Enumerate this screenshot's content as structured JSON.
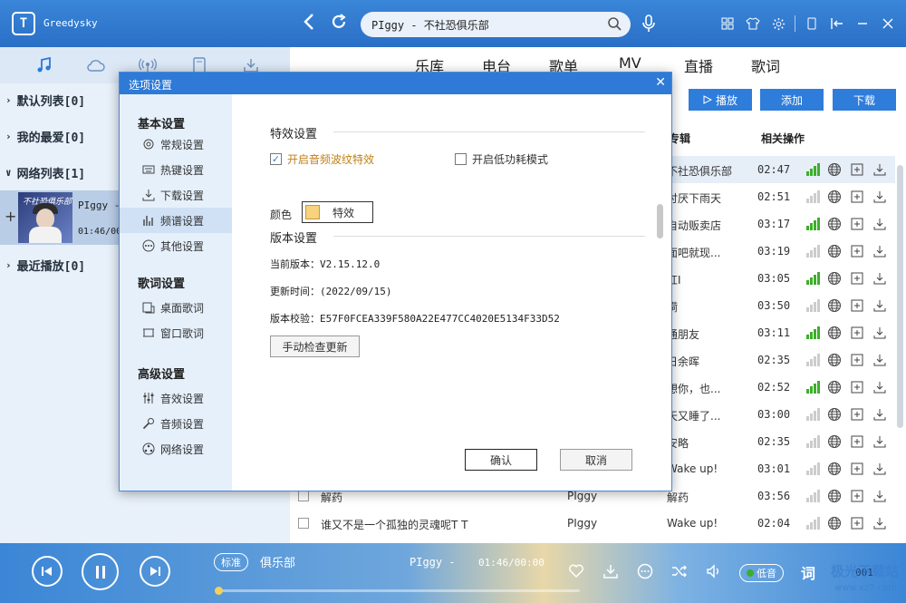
{
  "app": {
    "logo_letter": "T",
    "name": "Greedysky"
  },
  "search": {
    "value": "PIggy - 不社恐俱乐部"
  },
  "left": {
    "tabs": [
      "music-icon",
      "cloud-icon",
      "radio-icon",
      "device-icon",
      "download-icon"
    ],
    "lists": [
      {
        "label": "默认列表[0]",
        "arrow": "›"
      },
      {
        "label": "我的最爱[0]",
        "arrow": "›"
      },
      {
        "label": "网络列表[1]",
        "arrow": "∨"
      },
      {
        "label": "最近播放[0]",
        "arrow": "›"
      }
    ],
    "now": {
      "title": "PIggy -",
      "time": "01:46/00",
      "cover_caption": "不社恐俱乐部",
      "plus": "+"
    }
  },
  "main": {
    "tabs": [
      "乐库",
      "电台",
      "歌单",
      "MV",
      "直播",
      "歌词"
    ],
    "buttons": {
      "play": "播放",
      "add": "添加",
      "download": "下载"
    },
    "headers": {
      "album": "专辑",
      "ops": "相关操作"
    },
    "rows": [
      {
        "name": "",
        "singer": "",
        "album": "不社恐俱乐部",
        "dur": "02:47",
        "bars": 3,
        "hl": true
      },
      {
        "name": "",
        "singer": "",
        "album": "讨厌下雨天",
        "dur": "02:51",
        "bars": 0
      },
      {
        "name": "",
        "singer": "",
        "album": "自动贩卖店",
        "dur": "03:17",
        "bars": 3
      },
      {
        "name": "",
        "singer": "",
        "album": "面吧就现...",
        "dur": "03:19",
        "bars": 0
      },
      {
        "name": "",
        "singer": "",
        "album": "红I",
        "dur": "03:05",
        "bars": 3
      },
      {
        "name": "",
        "singer": "",
        "album": "嗬",
        "dur": "03:50",
        "bars": 0
      },
      {
        "name": "",
        "singer": "",
        "album": "通朋友",
        "dur": "03:11",
        "bars": 3
      },
      {
        "name": "",
        "singer": "",
        "album": "日余晖",
        "dur": "02:35",
        "bars": 0
      },
      {
        "name": "",
        "singer": "",
        "album": "想你，也...",
        "dur": "02:52",
        "bars": 3
      },
      {
        "name": "",
        "singer": "",
        "album": "天又睡了...",
        "dur": "03:00",
        "bars": 0
      },
      {
        "name": "",
        "singer": "",
        "album": "安略",
        "dur": "02:35",
        "bars": 0
      },
      {
        "name": "",
        "singer": "",
        "album": "Wake up!",
        "dur": "03:01",
        "bars": 0
      },
      {
        "name": "解药",
        "singer": "PIggy",
        "album": "解药",
        "dur": "03:56",
        "bars": 0
      },
      {
        "name": "谁又不是一个孤独的灵魂呢T T",
        "singer": "PIggy",
        "album": "Wake up!",
        "dur": "02:04",
        "bars": 0
      }
    ]
  },
  "dialog": {
    "title": "选项设置",
    "close": "✕",
    "nav": {
      "basic": {
        "title": "基本设置",
        "items": [
          "常规设置",
          "热键设置",
          "下载设置",
          "频谱设置",
          "其他设置"
        ]
      },
      "lyric": {
        "title": "歌词设置",
        "items": [
          "桌面歌词",
          "窗口歌词"
        ]
      },
      "advanced": {
        "title": "高级设置",
        "items": [
          "音效设置",
          "音频设置",
          "网络设置"
        ]
      }
    },
    "effects": {
      "title": "特效设置",
      "wave_label": "开启音频波纹特效",
      "lowpower_label": "开启低功耗模式",
      "color_label": "颜色",
      "color_button": "特效",
      "color_value": "#f7d37e"
    },
    "version": {
      "title": "版本设置",
      "current": "当前版本：V2.15.12.0",
      "updated": "更新时间：(2022/09/15)",
      "checksum": "版本校验：E57F0FCEA339F580A22E477CC4020E5134F33D52",
      "check_button": "手动检查更新"
    },
    "ok": "确认",
    "cancel": "取消"
  },
  "player": {
    "mode": "标准",
    "song_tail": "俱乐部",
    "song": "PIggy -",
    "time": "01:46/00:00",
    "quality": "低音",
    "lyric": "词",
    "count": "001",
    "progress": 0,
    "watermark": "极光下载站",
    "watermark_url": "www.xz7.com"
  },
  "colors": {
    "accent": "#2e7ad6",
    "hq": "#3dae2b"
  }
}
